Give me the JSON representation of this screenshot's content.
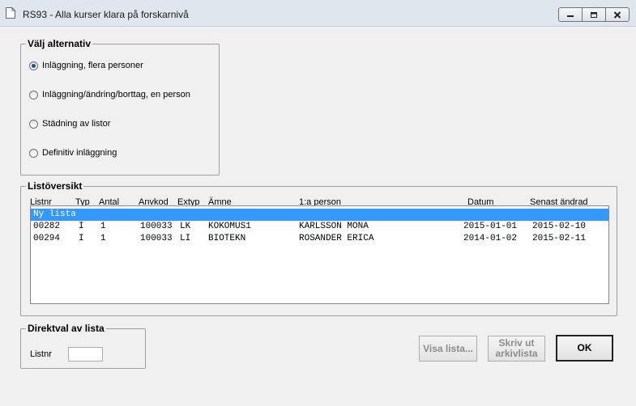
{
  "window": {
    "title": "RS93 - Alla kurser klara på forskarnivå"
  },
  "options": {
    "legend": "Välj alternativ",
    "items": [
      {
        "label": "Inläggning, flera personer",
        "checked": true
      },
      {
        "label": "Inläggning/ändring/borttag, en person",
        "checked": false
      },
      {
        "label": "Städning av listor",
        "checked": false
      },
      {
        "label": "Definitiv inläggning",
        "checked": false
      }
    ]
  },
  "overview": {
    "legend": "Listöversikt",
    "columns": [
      "Listnr",
      "Typ",
      "Antal",
      "Anvkod",
      "Extyp",
      "Ämne",
      "1:a person",
      "Datum",
      "Senast ändrad"
    ],
    "new_list": "Ny lista",
    "rows": [
      {
        "listnr": "00282",
        "typ": "I",
        "antal": "1",
        "anvkod": "100033",
        "extyp": "LK",
        "amne": "KOKOMUS1",
        "person": "KARLSSON MONA",
        "datum": "2015-01-01",
        "senast": "2015-02-10"
      },
      {
        "listnr": "00294",
        "typ": "I",
        "antal": "1",
        "anvkod": "100033",
        "extyp": "LI",
        "amne": "BIOTEKN",
        "person": "ROSANDER ERICA",
        "datum": "2014-01-02",
        "senast": "2015-02-11"
      }
    ]
  },
  "direct": {
    "legend": "Direktval av lista",
    "label": "Listnr",
    "value": ""
  },
  "buttons": {
    "visa": "Visa lista...",
    "skriv_line1": "Skriv ut",
    "skriv_line2": "arkivlista",
    "ok": "OK"
  }
}
